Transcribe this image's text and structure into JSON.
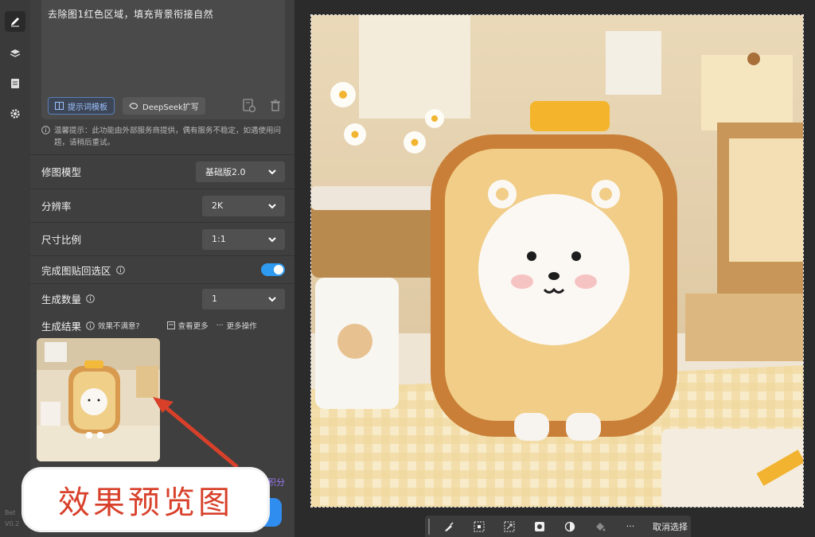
{
  "prompt": {
    "text": "去除图1红色区域，填充背景衔接自然",
    "template_button": "提示词模板",
    "deepseek_button": "DeepSeek扩写"
  },
  "tip": {
    "text": "温馨提示：此功能由外部服务商提供，偶有服务不稳定，如遇使用问题，请稍后重试。"
  },
  "settings": {
    "model": {
      "label": "修图模型",
      "value": "基础版2.0"
    },
    "resolution": {
      "label": "分辨率",
      "value": "2K"
    },
    "ratio": {
      "label": "尺寸比例",
      "value": "1:1"
    },
    "paste_back": {
      "label": "完成图贴回选区",
      "enabled": true
    },
    "count": {
      "label": "生成数量",
      "value": "1"
    }
  },
  "results": {
    "label": "生成结果",
    "feedback": "效果不满意?",
    "view_more": "查看更多",
    "more_actions": "更多操作"
  },
  "version": {
    "line1": "Bet",
    "line2": "V0.2"
  },
  "credit_fragment": "积分",
  "callout": {
    "text": "效果预览图",
    "color": "#d8402a"
  },
  "canvas_toolbar": {
    "cancel_selection": "取消选择",
    "more": "···"
  },
  "colors": {
    "accent_blue": "#2f9bf0",
    "panel_bg": "#3f3f3f",
    "canvas_bg": "#2b2b2b"
  }
}
